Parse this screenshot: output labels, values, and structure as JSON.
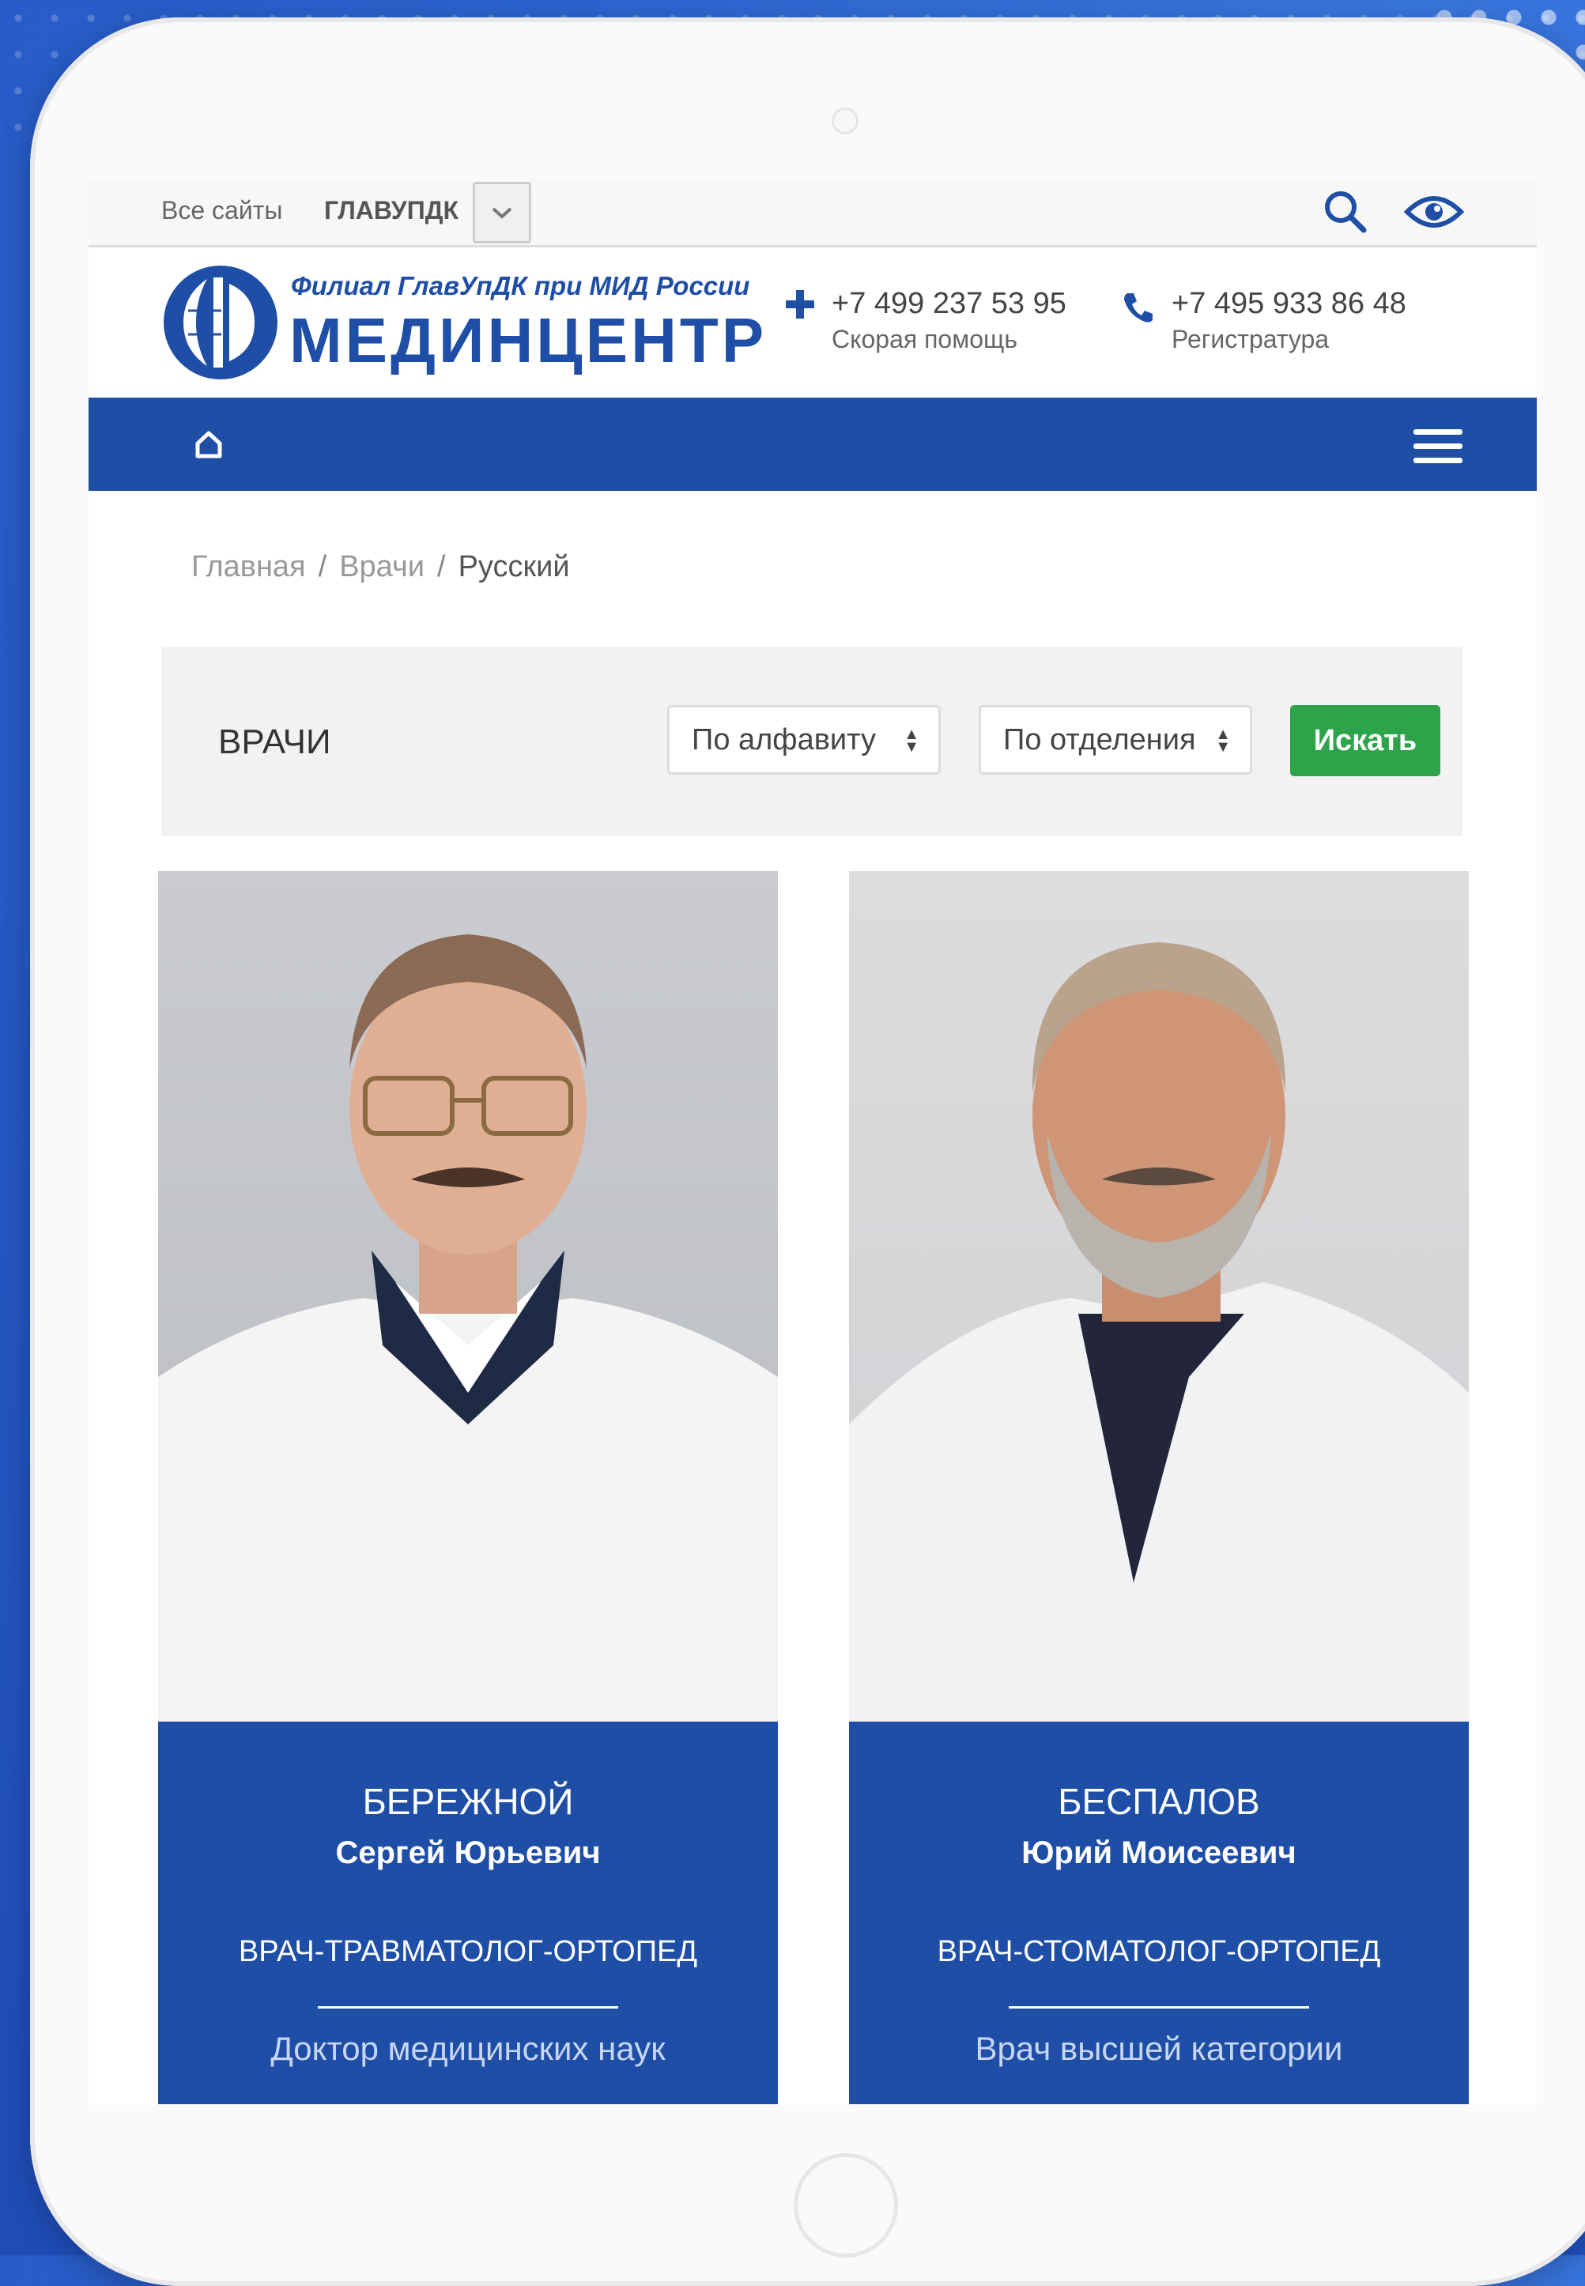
{
  "topbar": {
    "all_sites": "Все сайты",
    "org": "ГЛАВУПДК"
  },
  "header": {
    "logo_subtitle": "Филиал ГлавУпДК при МИД России",
    "logo_title": "МЕДИНЦЕНТР",
    "phone_emergency": "+7 499 237 53 95",
    "phone_emergency_label": "Скорая помощь",
    "phone_registry": "+7 495 933 86 48",
    "phone_registry_label": "Регистратура"
  },
  "breadcrumb": {
    "home": "Главная",
    "doctors": "Врачи",
    "current": "Русский",
    "separator": "/"
  },
  "filter": {
    "title": "ВРАЧИ",
    "sort_select": "По алфавиту",
    "department_select": "По отделения",
    "search_button": "Искать"
  },
  "doctors": [
    {
      "surname": "БЕРЕЖНОЙ",
      "given_names": "Сергей Юрьевич",
      "specialty": "ВРАЧ-ТРАВМАТОЛОГ-ОРТОПЕД",
      "degree": "Доктор медицинских наук"
    },
    {
      "surname": "БЕСПАЛОВ",
      "given_names": "Юрий Моисеевич",
      "specialty": "ВРАЧ-СТОМАТОЛОГ-ОРТОПЕД",
      "degree": "Врач высшей категории"
    }
  ],
  "colors": {
    "brand_blue": "#1e4ea6",
    "search_green": "#2ea44a",
    "background_blue": "#2c63cf"
  },
  "icons": {
    "search": "search-icon",
    "accessibility": "eye-icon",
    "home": "home-icon",
    "menu": "hamburger-icon",
    "emergency": "plus-icon",
    "registry": "phone-icon",
    "dropdown": "chevron-down-icon"
  }
}
